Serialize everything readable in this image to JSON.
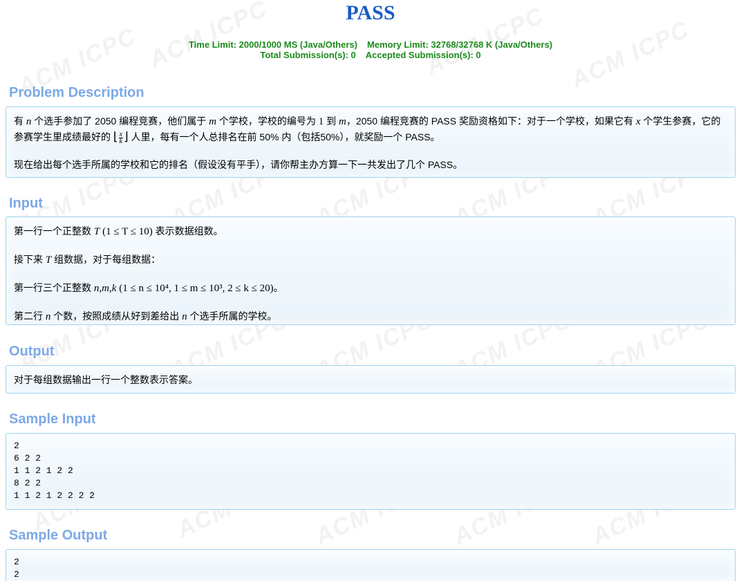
{
  "problem": {
    "title": "PASS",
    "time_limit": "Time Limit: 2000/1000 MS (Java/Others)",
    "memory_limit": "Memory Limit: 32768/32768 K (Java/Others)",
    "total_submissions": "Total Submission(s): 0",
    "accepted_submissions": "Accepted Submission(s): 0"
  },
  "watermark": "ACM ICPC",
  "sections": {
    "description": {
      "heading": "Problem Description",
      "p1": {
        "a": "有 ",
        "n": "n",
        "b": " 个选手参加了 2050 编程竞赛，他们属于 ",
        "m": "m",
        "c": " 个学校，学校的编号为 ",
        "one": "1",
        "d": " 到 ",
        "m2": "m",
        "e": "，2050 编程竞赛的 PASS 奖励资格如下：对于一个学校，如果它有 ",
        "x": "x",
        "f": " 个学生参赛，它的参赛学生里成绩最好的 ",
        "frac_top": "x",
        "frac_bot": "k",
        "g": " 人里，每有一个人总排名在前 50% 内（包括50%），就奖励一个 PASS。"
      },
      "p2": "现在给出每个选手所属的学校和它的排名（假设没有平手），请你帮主办方算一下一共发出了几个 PASS。"
    },
    "input": {
      "heading": "Input",
      "p1_a": "第一行一个正整数 ",
      "p1_T": "T",
      "p1_math": "(1 ≤ T ≤ 10)",
      "p1_b": " 表示数据组数。",
      "p2_a": "接下来 ",
      "p2_T": "T",
      "p2_b": " 组数据，对于每组数据：",
      "p3_a": "第一行三个正整数 ",
      "p3_vars": "n,m,k",
      "p3_math": "(1 ≤ n ≤ 10⁴, 1 ≤ m ≤ 10³, 2 ≤ k ≤ 20)",
      "p3_b": "。",
      "p4_a": "第二行 ",
      "p4_n": "n",
      "p4_b": " 个数，按照成绩从好到差给出 ",
      "p4_n2": "n",
      "p4_c": " 个选手所属的学校。"
    },
    "output": {
      "heading": "Output",
      "text": "对于每组数据输出一行一个整数表示答案。"
    },
    "sample_input": {
      "heading": "Sample Input",
      "code": "2\n6 2 2\n1 1 2 1 2 2\n8 2 2\n1 1 2 1 2 2 2 2"
    },
    "sample_output": {
      "heading": "Sample Output",
      "code": "2\n2"
    }
  }
}
